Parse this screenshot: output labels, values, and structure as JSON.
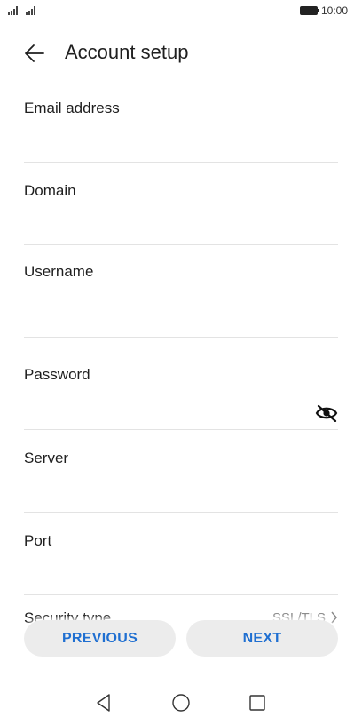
{
  "status_bar": {
    "time": "10:00",
    "icons": [
      "signal-icon",
      "signal-icon",
      "battery-icon"
    ]
  },
  "header": {
    "title": "Account setup",
    "back_icon": "arrow-left-icon"
  },
  "form": {
    "fields": [
      {
        "label": "Email address",
        "value": ""
      },
      {
        "label": "Domain",
        "value": ""
      },
      {
        "label": "Username",
        "value": ""
      },
      {
        "label": "Password",
        "value": "",
        "toggle_icon": "eye-off-icon"
      },
      {
        "label": "Server",
        "value": ""
      },
      {
        "label": "Port",
        "value": ""
      }
    ],
    "security": {
      "label": "Security type",
      "value": "SSL/TLS",
      "chevron_icon": "chevron-right-icon"
    }
  },
  "buttons": {
    "previous": "PREVIOUS",
    "next": "NEXT"
  },
  "nav": {
    "icons": [
      "back-triangle-icon",
      "home-circle-icon",
      "recents-square-icon"
    ]
  },
  "colors": {
    "accent": "#1f6fd1",
    "button_bg": "#ececec",
    "divider": "#e3e3e3"
  }
}
